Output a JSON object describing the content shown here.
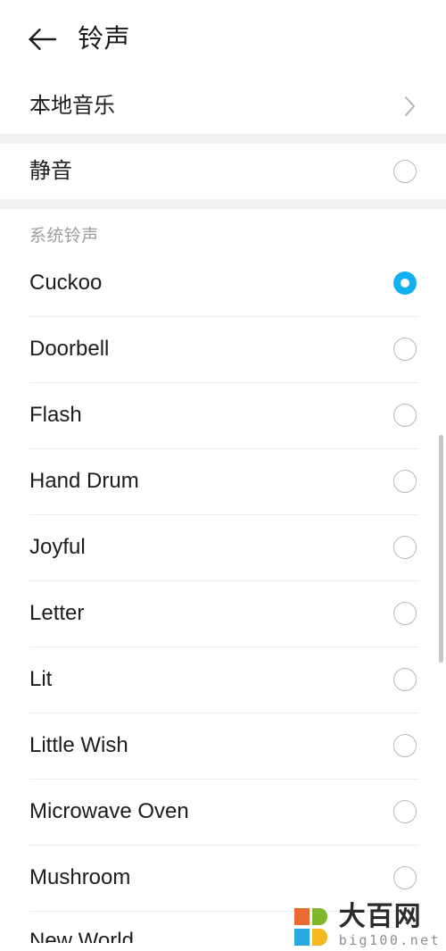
{
  "header": {
    "back_icon": "arrow-left-icon",
    "title": "铃声"
  },
  "local_music": {
    "label": "本地音乐",
    "chevron_icon": "chevron-right-icon"
  },
  "silent": {
    "label": "静音",
    "selected": false
  },
  "section": {
    "title": "系统铃声"
  },
  "colors": {
    "accent": "#13b0ef",
    "text_primary": "#1c1c1c",
    "text_secondary": "#9d9d9d",
    "divider": "#ececec",
    "band": "#f1f1f1",
    "radio_off_border": "#b9b9b9",
    "scrollbar": "#c6c6c6"
  },
  "ringtones": [
    {
      "label": "Cuckoo",
      "selected": true
    },
    {
      "label": "Doorbell",
      "selected": false
    },
    {
      "label": "Flash",
      "selected": false
    },
    {
      "label": "Hand Drum",
      "selected": false
    },
    {
      "label": "Joyful",
      "selected": false
    },
    {
      "label": "Letter",
      "selected": false
    },
    {
      "label": "Lit",
      "selected": false
    },
    {
      "label": "Little Wish",
      "selected": false
    },
    {
      "label": "Microwave Oven",
      "selected": false
    },
    {
      "label": "Mushroom",
      "selected": false
    },
    {
      "label": "New World",
      "selected": false
    }
  ],
  "watermark": {
    "name": "大百网",
    "url": "big100.net",
    "logo_colors": {
      "top_left": "#ea6a30",
      "top_right": "#80b72a",
      "bottom_left": "#28a8e0",
      "bottom_right": "#f5b722"
    }
  }
}
